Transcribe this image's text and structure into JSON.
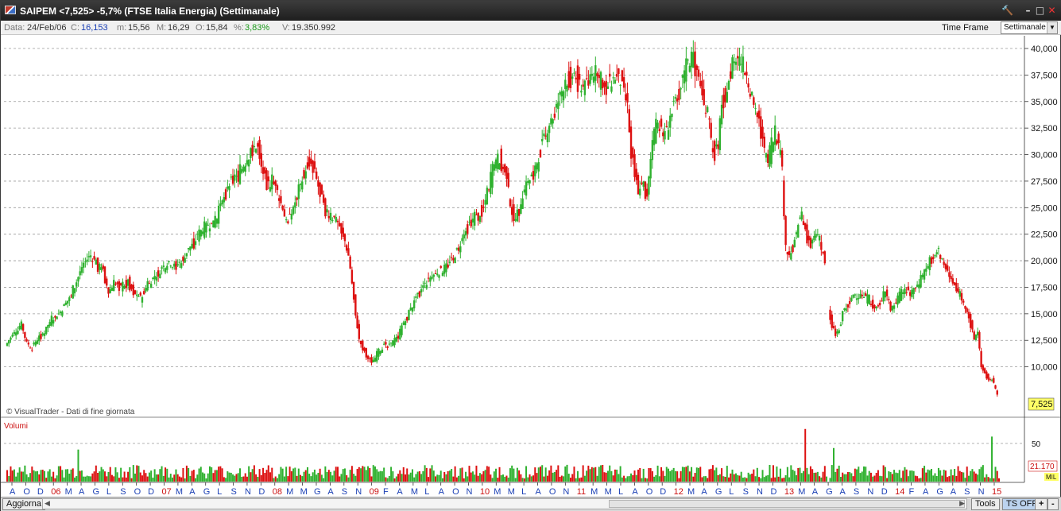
{
  "window": {
    "title": "SAIPEM <7,525> -5,7% (FTSE Italia Energia) (Settimanale)",
    "buttons": {
      "tools": "🔨",
      "minimize": "–",
      "maximize": "□",
      "close": "✕"
    }
  },
  "info": {
    "data_label": "Data:",
    "data_value": "24/Feb/06",
    "c_label": "C:",
    "c_value": "16,153",
    "m_label": "m:",
    "m_value": "15,56",
    "M_label": "M:",
    "M_value": "16,29",
    "o_label": "O:",
    "o_value": "15,84",
    "pct_label": "%:",
    "pct_value": "3,83%",
    "v_label": "V:",
    "v_value": "19.350.992",
    "timeframe_label": "Time Frame",
    "timeframe_value": "Settimanale"
  },
  "chart": {
    "watermark": "© VisualTrader - Dati di fine giornata",
    "last_price": "7,525",
    "volume_title": "Volumi",
    "volume_tick": "50",
    "volume_last": "21.170",
    "volume_unit": "MIL",
    "colors": {
      "up": "#2fb12f",
      "down": "#dd1111",
      "grid": "#9a9a9a",
      "axis_text": "#111111",
      "label_blue": "#1a3fb5",
      "label_red": "#cc1111",
      "price_badge": "#ffff66"
    }
  },
  "bottom": {
    "refresh_label": "Aggiorna",
    "tools_label": "Tools",
    "tsoff_label": "TS OFF",
    "plus_label": "+",
    "minus_label": "-"
  },
  "chart_data": {
    "type": "candlestick",
    "y_axis": {
      "min": 7500,
      "max": 40000,
      "ticks": [
        "40,000",
        "37,500",
        "35,000",
        "32,500",
        "30,000",
        "27,500",
        "25,000",
        "22,500",
        "20,000",
        "17,500",
        "15,000",
        "12,500",
        "10,000"
      ]
    },
    "x_tick_labels": [
      {
        "t": "A",
        "color": "blue"
      },
      {
        "t": "O",
        "color": "blue"
      },
      {
        "t": "D",
        "color": "blue"
      },
      {
        "t": "06",
        "color": "red"
      },
      {
        "t": "M",
        "color": "blue"
      },
      {
        "t": "A",
        "color": "blue"
      },
      {
        "t": "G",
        "color": "blue"
      },
      {
        "t": "L",
        "color": "blue"
      },
      {
        "t": "S",
        "color": "blue"
      },
      {
        "t": "O",
        "color": "blue"
      },
      {
        "t": "D",
        "color": "blue"
      },
      {
        "t": "07",
        "color": "red"
      },
      {
        "t": "M",
        "color": "blue"
      },
      {
        "t": "A",
        "color": "blue"
      },
      {
        "t": "G",
        "color": "blue"
      },
      {
        "t": "L",
        "color": "blue"
      },
      {
        "t": "S",
        "color": "blue"
      },
      {
        "t": "N",
        "color": "blue"
      },
      {
        "t": "D",
        "color": "blue"
      },
      {
        "t": "08",
        "color": "red"
      },
      {
        "t": "M",
        "color": "blue"
      },
      {
        "t": "M",
        "color": "blue"
      },
      {
        "t": "G",
        "color": "blue"
      },
      {
        "t": "A",
        "color": "blue"
      },
      {
        "t": "S",
        "color": "blue"
      },
      {
        "t": "N",
        "color": "blue"
      },
      {
        "t": "09",
        "color": "red"
      },
      {
        "t": "F",
        "color": "blue"
      },
      {
        "t": "A",
        "color": "blue"
      },
      {
        "t": "M",
        "color": "blue"
      },
      {
        "t": "L",
        "color": "blue"
      },
      {
        "t": "A",
        "color": "blue"
      },
      {
        "t": "O",
        "color": "blue"
      },
      {
        "t": "N",
        "color": "blue"
      },
      {
        "t": "10",
        "color": "red"
      },
      {
        "t": "M",
        "color": "blue"
      },
      {
        "t": "M",
        "color": "blue"
      },
      {
        "t": "L",
        "color": "blue"
      },
      {
        "t": "A",
        "color": "blue"
      },
      {
        "t": "O",
        "color": "blue"
      },
      {
        "t": "N",
        "color": "blue"
      },
      {
        "t": "11",
        "color": "red"
      },
      {
        "t": "M",
        "color": "blue"
      },
      {
        "t": "M",
        "color": "blue"
      },
      {
        "t": "L",
        "color": "blue"
      },
      {
        "t": "A",
        "color": "blue"
      },
      {
        "t": "O",
        "color": "blue"
      },
      {
        "t": "D",
        "color": "blue"
      },
      {
        "t": "12",
        "color": "red"
      },
      {
        "t": "M",
        "color": "blue"
      },
      {
        "t": "A",
        "color": "blue"
      },
      {
        "t": "G",
        "color": "blue"
      },
      {
        "t": "L",
        "color": "blue"
      },
      {
        "t": "S",
        "color": "blue"
      },
      {
        "t": "N",
        "color": "blue"
      },
      {
        "t": "D",
        "color": "blue"
      },
      {
        "t": "13",
        "color": "red"
      },
      {
        "t": "M",
        "color": "blue"
      },
      {
        "t": "A",
        "color": "blue"
      },
      {
        "t": "G",
        "color": "blue"
      },
      {
        "t": "A",
        "color": "blue"
      },
      {
        "t": "S",
        "color": "blue"
      },
      {
        "t": "N",
        "color": "blue"
      },
      {
        "t": "D",
        "color": "blue"
      },
      {
        "t": "14",
        "color": "red"
      },
      {
        "t": "F",
        "color": "blue"
      },
      {
        "t": "A",
        "color": "blue"
      },
      {
        "t": "G",
        "color": "blue"
      },
      {
        "t": "A",
        "color": "blue"
      },
      {
        "t": "S",
        "color": "blue"
      },
      {
        "t": "N",
        "color": "blue"
      },
      {
        "t": "15",
        "color": "red"
      }
    ],
    "price_path": [
      [
        0,
        12000
      ],
      [
        10,
        13200
      ],
      [
        18,
        14000
      ],
      [
        24,
        12200
      ],
      [
        30,
        11800
      ],
      [
        36,
        12600
      ],
      [
        44,
        13300
      ],
      [
        52,
        14500
      ],
      [
        62,
        15200
      ],
      [
        72,
        16500
      ],
      [
        80,
        18000
      ],
      [
        88,
        19800
      ],
      [
        96,
        20500
      ],
      [
        104,
        19500
      ],
      [
        110,
        19000
      ],
      [
        116,
        17000
      ],
      [
        122,
        17800
      ],
      [
        130,
        17500
      ],
      [
        138,
        18000
      ],
      [
        146,
        16800
      ],
      [
        152,
        16500
      ],
      [
        160,
        17800
      ],
      [
        168,
        18500
      ],
      [
        176,
        19300
      ],
      [
        184,
        20000
      ],
      [
        190,
        19500
      ],
      [
        196,
        19800
      ],
      [
        204,
        20800
      ],
      [
        210,
        21500
      ],
      [
        218,
        22500
      ],
      [
        226,
        23200
      ],
      [
        234,
        23500
      ],
      [
        240,
        24500
      ],
      [
        248,
        26500
      ],
      [
        256,
        27800
      ],
      [
        262,
        28000
      ],
      [
        268,
        29000
      ],
      [
        276,
        30300
      ],
      [
        284,
        31000
      ],
      [
        290,
        28000
      ],
      [
        296,
        27200
      ],
      [
        300,
        27500
      ],
      [
        306,
        26500
      ],
      [
        312,
        25000
      ],
      [
        316,
        23500
      ],
      [
        320,
        24000
      ],
      [
        326,
        25500
      ],
      [
        332,
        27500
      ],
      [
        338,
        28800
      ],
      [
        342,
        29500
      ],
      [
        348,
        28200
      ],
      [
        352,
        27000
      ],
      [
        358,
        25200
      ],
      [
        364,
        24200
      ],
      [
        370,
        24000
      ],
      [
        374,
        23600
      ],
      [
        380,
        22500
      ],
      [
        386,
        20500
      ],
      [
        392,
        16500
      ],
      [
        398,
        12500
      ],
      [
        404,
        11500
      ],
      [
        408,
        10800
      ],
      [
        414,
        10500
      ],
      [
        420,
        11500
      ],
      [
        426,
        12000
      ],
      [
        430,
        11800
      ],
      [
        436,
        12300
      ],
      [
        442,
        12900
      ],
      [
        448,
        14000
      ],
      [
        456,
        15400
      ],
      [
        464,
        16700
      ],
      [
        470,
        17600
      ],
      [
        478,
        18300
      ],
      [
        484,
        18900
      ],
      [
        490,
        19000
      ],
      [
        496,
        19400
      ],
      [
        502,
        20000
      ],
      [
        508,
        20900
      ],
      [
        514,
        22000
      ],
      [
        520,
        23200
      ],
      [
        526,
        23900
      ],
      [
        532,
        24200
      ],
      [
        538,
        25200
      ],
      [
        544,
        27000
      ],
      [
        550,
        29000
      ],
      [
        556,
        29700
      ],
      [
        562,
        28500
      ],
      [
        566,
        26500
      ],
      [
        570,
        24600
      ],
      [
        576,
        24200
      ],
      [
        582,
        26300
      ],
      [
        588,
        27300
      ],
      [
        594,
        28200
      ],
      [
        600,
        29800
      ],
      [
        606,
        31500
      ],
      [
        612,
        33000
      ],
      [
        618,
        33800
      ],
      [
        622,
        35000
      ],
      [
        628,
        36500
      ],
      [
        634,
        37200
      ],
      [
        640,
        37600
      ],
      [
        646,
        36700
      ],
      [
        652,
        36200
      ],
      [
        658,
        37300
      ],
      [
        662,
        37800
      ],
      [
        668,
        37100
      ],
      [
        674,
        36200
      ],
      [
        680,
        36700
      ],
      [
        686,
        37300
      ],
      [
        692,
        36900
      ],
      [
        696,
        35700
      ],
      [
        700,
        34500
      ],
      [
        704,
        30000
      ],
      [
        708,
        28600
      ],
      [
        712,
        26700
      ],
      [
        716,
        27500
      ],
      [
        722,
        25800
      ],
      [
        728,
        31400
      ],
      [
        734,
        33000
      ],
      [
        740,
        31700
      ],
      [
        744,
        32200
      ],
      [
        750,
        34000
      ],
      [
        756,
        35400
      ],
      [
        762,
        37000
      ],
      [
        766,
        38300
      ],
      [
        772,
        39100
      ],
      [
        778,
        38000
      ],
      [
        782,
        36700
      ],
      [
        786,
        35000
      ],
      [
        790,
        34000
      ],
      [
        794,
        31400
      ],
      [
        798,
        30000
      ],
      [
        802,
        31000
      ],
      [
        806,
        34700
      ],
      [
        812,
        36500
      ],
      [
        818,
        38500
      ],
      [
        822,
        38900
      ],
      [
        828,
        38700
      ],
      [
        834,
        37500
      ],
      [
        840,
        35400
      ],
      [
        844,
        34000
      ],
      [
        848,
        33000
      ],
      [
        852,
        31200
      ],
      [
        856,
        29500
      ],
      [
        860,
        30000
      ],
      [
        866,
        32200
      ],
      [
        870,
        30800
      ],
      [
        874,
        28400
      ],
      [
        878,
        21000
      ],
      [
        882,
        20400
      ],
      [
        886,
        21400
      ],
      [
        890,
        22300
      ],
      [
        894,
        24600
      ],
      [
        898,
        23200
      ],
      [
        902,
        22300
      ],
      [
        906,
        21500
      ],
      [
        910,
        22300
      ],
      [
        914,
        22500
      ],
      [
        918,
        21000
      ],
      [
        922,
        20100
      ]
    ],
    "price_path2": [
      [
        926,
        15200
      ],
      [
        930,
        14000
      ],
      [
        934,
        13000
      ],
      [
        938,
        13500
      ],
      [
        942,
        15200
      ],
      [
        946,
        15600
      ],
      [
        950,
        16200
      ],
      [
        954,
        16800
      ],
      [
        960,
        16700
      ],
      [
        966,
        16500
      ],
      [
        972,
        16300
      ],
      [
        978,
        15500
      ],
      [
        984,
        16000
      ],
      [
        990,
        17300
      ],
      [
        996,
        15400
      ],
      [
        1000,
        15900
      ],
      [
        1006,
        16700
      ],
      [
        1012,
        17200
      ],
      [
        1018,
        16800
      ],
      [
        1024,
        17500
      ],
      [
        1030,
        18200
      ],
      [
        1036,
        19200
      ],
      [
        1040,
        19900
      ],
      [
        1046,
        20600
      ],
      [
        1050,
        21000
      ],
      [
        1054,
        19900
      ],
      [
        1058,
        19300
      ],
      [
        1062,
        18500
      ],
      [
        1068,
        17700
      ],
      [
        1072,
        17000
      ],
      [
        1078,
        16200
      ],
      [
        1082,
        15300
      ],
      [
        1086,
        14000
      ],
      [
        1090,
        12600
      ],
      [
        1094,
        13300
      ],
      [
        1098,
        10100
      ],
      [
        1102,
        9300
      ],
      [
        1106,
        9000
      ],
      [
        1110,
        8700
      ],
      [
        1114,
        8000
      ],
      [
        1116,
        7525
      ]
    ],
    "volume_spikes": [
      [
        79,
        4.2
      ],
      [
        897,
        6.9
      ],
      [
        929,
        4.4
      ],
      [
        1107,
        5.9
      ],
      [
        1117,
        5.6
      ],
      [
        1121,
        3.0
      ]
    ],
    "volume_tick_value": 50,
    "volume_last_value": 21170
  }
}
